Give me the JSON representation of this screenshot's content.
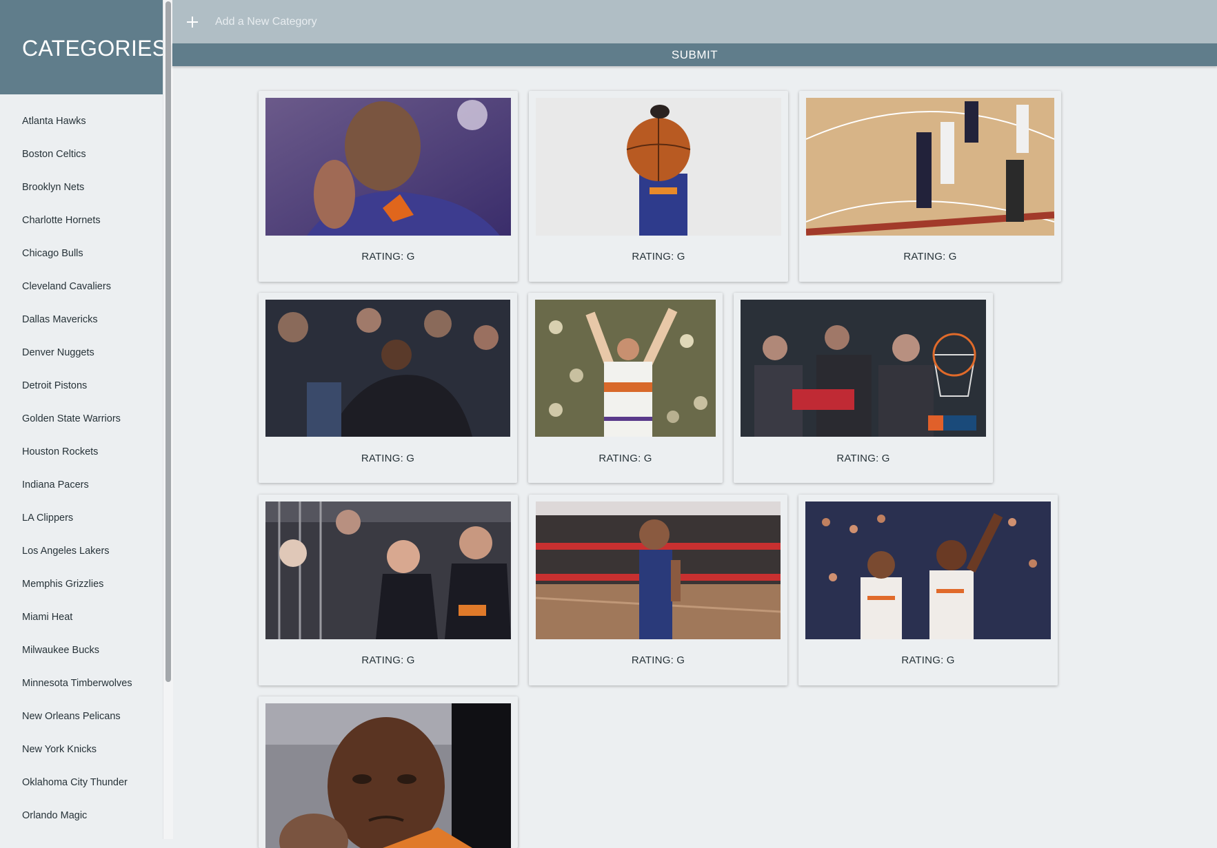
{
  "sidebar": {
    "title": "CATEGORIES",
    "items": [
      {
        "label": "Atlanta Hawks"
      },
      {
        "label": "Boston Celtics"
      },
      {
        "label": "Brooklyn Nets"
      },
      {
        "label": "Charlotte Hornets"
      },
      {
        "label": "Chicago Bulls"
      },
      {
        "label": "Cleveland Cavaliers"
      },
      {
        "label": "Dallas Mavericks"
      },
      {
        "label": "Denver Nuggets"
      },
      {
        "label": "Detroit Pistons"
      },
      {
        "label": "Golden State Warriors"
      },
      {
        "label": "Houston Rockets"
      },
      {
        "label": "Indiana Pacers"
      },
      {
        "label": "LA Clippers"
      },
      {
        "label": "Los Angeles Lakers"
      },
      {
        "label": "Memphis Grizzlies"
      },
      {
        "label": "Miami Heat"
      },
      {
        "label": "Milwaukee Bucks"
      },
      {
        "label": "Minnesota Timberwolves"
      },
      {
        "label": "New Orleans Pelicans"
      },
      {
        "label": "New York Knicks"
      },
      {
        "label": "Oklahoma City Thunder"
      },
      {
        "label": "Orlando Magic"
      }
    ]
  },
  "form": {
    "add_icon": "plus-icon",
    "placeholder": "Add a New Category",
    "value": "",
    "submit_label": "SUBMIT"
  },
  "gifs": [
    {
      "rating": "RATING: G"
    },
    {
      "rating": "RATING: G"
    },
    {
      "rating": "RATING: G"
    },
    {
      "rating": "RATING: G"
    },
    {
      "rating": "RATING: G"
    },
    {
      "rating": "RATING: G"
    },
    {
      "rating": "RATING: G"
    },
    {
      "rating": "RATING: G"
    },
    {
      "rating": "RATING: G"
    },
    {
      "rating": ""
    }
  ],
  "colors": {
    "primary": "#607d8b",
    "topbar": "#b0bec5",
    "background": "#eceff1"
  }
}
